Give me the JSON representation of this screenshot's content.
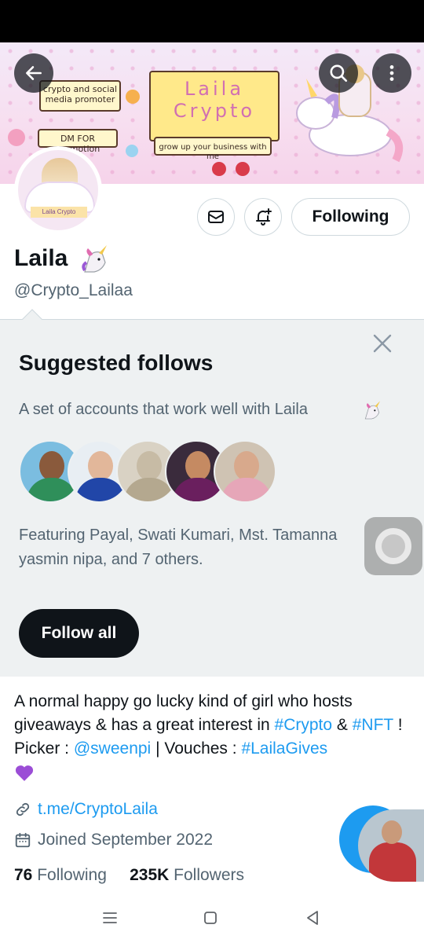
{
  "banner": {
    "sign_left_top": "crypto and social media promoter",
    "sign_left_bottom": "DM FOR promotion",
    "title": "Laila Crypto",
    "tagline": "grow up your business with me",
    "avatar_tag": "Laila Crypto"
  },
  "header": {
    "back_icon": "arrow-left-icon",
    "search_icon": "search-icon",
    "more_icon": "more-vertical-icon"
  },
  "profile": {
    "name": "Laila",
    "name_emoji": "unicorn",
    "handle": "@Crypto_Lailaa",
    "following_button": "Following"
  },
  "suggested": {
    "title": "Suggested follows",
    "subtitle": "A set of accounts that work well with Laila",
    "featuring": "Featuring Payal, Swati Kumari, Mst. Tamanna yasmin nipa, and 7 others.",
    "follow_all": "Follow all"
  },
  "bio": {
    "text_1": "A normal happy go lucky kind of girl who hosts giveaways & has a great interest in ",
    "tag_crypto": "#Crypto",
    "text_2": " & ",
    "tag_nft": "#NFT",
    "text_3": " ! Picker : ",
    "mention": "@sweenpi",
    "text_4": " | Vouches : ",
    "tag_gives": "#LailaGives"
  },
  "meta": {
    "link": "t.me/CryptoLaila",
    "joined": "Joined September 2022"
  },
  "counts": {
    "following_count": "76",
    "following_label": "Following",
    "followers_count": "235K",
    "followers_label": "Followers"
  },
  "colors": {
    "accent": "#1d9bf0",
    "text": "#0f1419",
    "muted": "#536471",
    "panel": "#eef1f2"
  }
}
